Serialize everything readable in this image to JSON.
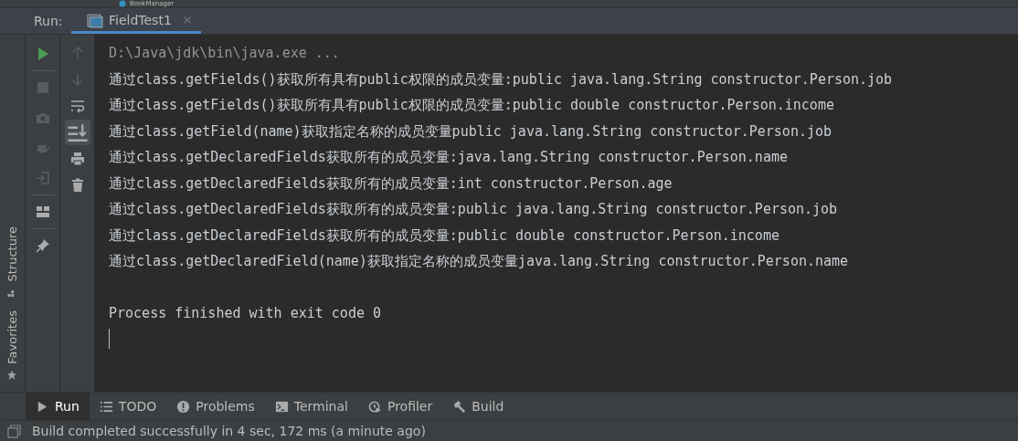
{
  "project_tree": {
    "item": "BookManager"
  },
  "run_panel": {
    "label": "Run:",
    "tabs": [
      {
        "label": "FieldTest1",
        "selected": true
      }
    ],
    "scroll_to_end_on": true
  },
  "console": {
    "lines": [
      {
        "kind": "command",
        "text": "D:\\Java\\jdk\\bin\\java.exe ..."
      },
      {
        "kind": "output",
        "text": "通过class.getFields()获取所有具有public权限的成员变量:public java.lang.String constructor.Person.job"
      },
      {
        "kind": "output",
        "text": "通过class.getFields()获取所有具有public权限的成员变量:public double constructor.Person.income"
      },
      {
        "kind": "output",
        "text": "通过class.getField(name)获取指定名称的成员变量public java.lang.String constructor.Person.job"
      },
      {
        "kind": "output",
        "text": "通过class.getDeclaredFields获取所有的成员变量:java.lang.String constructor.Person.name"
      },
      {
        "kind": "output",
        "text": "通过class.getDeclaredFields获取所有的成员变量:int constructor.Person.age"
      },
      {
        "kind": "output",
        "text": "通过class.getDeclaredFields获取所有的成员变量:public java.lang.String constructor.Person.job"
      },
      {
        "kind": "output",
        "text": "通过class.getDeclaredFields获取所有的成员变量:public double constructor.Person.income"
      },
      {
        "kind": "output",
        "text": "通过class.getDeclaredField(name)获取指定名称的成员变量java.lang.String constructor.Person.name"
      },
      {
        "kind": "blank"
      },
      {
        "kind": "output",
        "text": "Process finished with exit code 0"
      }
    ]
  },
  "side_tabs": [
    {
      "label": "Structure",
      "kind": "structure"
    },
    {
      "label": "Favorites",
      "kind": "favorites"
    }
  ],
  "bottom_tabs": [
    {
      "label": "Run",
      "kind": "run",
      "selected": true
    },
    {
      "label": "TODO",
      "kind": "todo",
      "selected": false
    },
    {
      "label": "Problems",
      "kind": "problems",
      "selected": false
    },
    {
      "label": "Terminal",
      "kind": "terminal",
      "selected": false
    },
    {
      "label": "Profiler",
      "kind": "profiler",
      "selected": false
    },
    {
      "label": "Build",
      "kind": "build",
      "selected": false
    }
  ],
  "status_bar": {
    "message": "Build completed successfully in 4 sec, 172 ms (a minute ago)"
  }
}
